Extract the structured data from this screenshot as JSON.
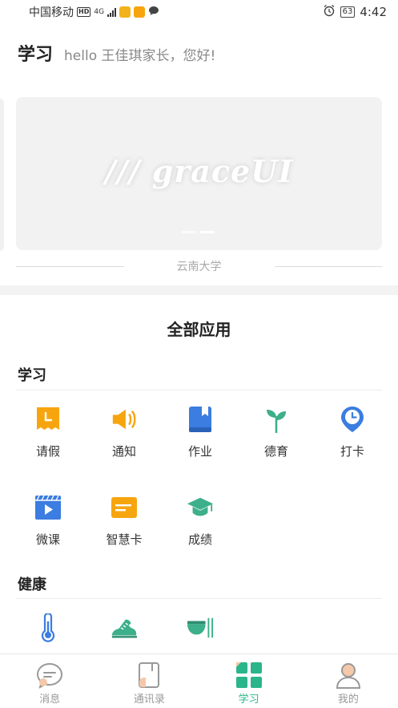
{
  "status_bar": {
    "carrier": "中国移动",
    "network_badge": "HD",
    "network_type": "4G",
    "battery": "63",
    "time": "4:42"
  },
  "header": {
    "title": "学习",
    "greeting": "hello 王佳琪家长，您好!"
  },
  "banner": {
    "logo_text": "/// graceUI",
    "caption": "云南大学",
    "slide_count": 2,
    "active_slide": 2
  },
  "all_apps": {
    "title": "全部应用",
    "groups": [
      {
        "label": "学习",
        "apps": [
          {
            "label": "请假",
            "icon": "leave-icon"
          },
          {
            "label": "通知",
            "icon": "megaphone-icon"
          },
          {
            "label": "作业",
            "icon": "book-icon"
          },
          {
            "label": "德育",
            "icon": "sprout-icon"
          },
          {
            "label": "打卡",
            "icon": "clock-pin-icon"
          },
          {
            "label": "微课",
            "icon": "video-icon"
          },
          {
            "label": "智慧卡",
            "icon": "card-icon"
          },
          {
            "label": "成绩",
            "icon": "graduation-cap-icon"
          }
        ]
      },
      {
        "label": "健康",
        "apps": [
          {
            "label": "",
            "icon": "thermometer-icon"
          },
          {
            "label": "",
            "icon": "sneaker-icon"
          },
          {
            "label": "",
            "icon": "bowl-icon"
          }
        ]
      }
    ]
  },
  "tabbar": {
    "tabs": [
      {
        "label": "消息",
        "icon": "message-icon",
        "active": false
      },
      {
        "label": "通讯录",
        "icon": "contacts-icon",
        "active": false
      },
      {
        "label": "学习",
        "icon": "grid-icon",
        "active": true
      },
      {
        "label": "我的",
        "icon": "user-icon",
        "active": false
      }
    ]
  },
  "colors": {
    "accent": "#2bb58b",
    "orange": "#f7a50f",
    "blue": "#3b7de0",
    "green": "#3daf8a"
  }
}
